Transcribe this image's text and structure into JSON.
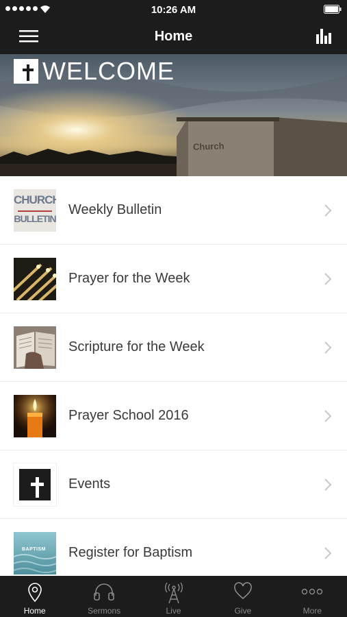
{
  "status_bar": {
    "time": "10:26 AM"
  },
  "nav": {
    "title": "Home"
  },
  "hero": {
    "welcome_text": "WELCOME",
    "building_sign": "Church"
  },
  "list": [
    {
      "label": "Weekly Bulletin",
      "thumb": "church-bulletin",
      "thumb_text_top": "CHURCH",
      "thumb_text_bottom": "BULLETIN"
    },
    {
      "label": "Prayer for the Week",
      "thumb": "candles"
    },
    {
      "label": "Scripture for the Week",
      "thumb": "open-bible"
    },
    {
      "label": "Prayer School 2016",
      "thumb": "candle-flame"
    },
    {
      "label": "Events",
      "thumb": "cross-logo"
    },
    {
      "label": "Register for Baptism",
      "thumb": "water",
      "thumb_text": "BAPTISM"
    }
  ],
  "tabs": [
    {
      "label": "Home",
      "icon": "location-pin-icon",
      "active": true
    },
    {
      "label": "Sermons",
      "icon": "headphones-icon",
      "active": false
    },
    {
      "label": "Live",
      "icon": "broadcast-tower-icon",
      "active": false
    },
    {
      "label": "Give",
      "icon": "heart-icon",
      "active": false
    },
    {
      "label": "More",
      "icon": "more-dots-icon",
      "active": false
    }
  ],
  "colors": {
    "bar_background": "#1c1c1c",
    "active_tab": "#ffffff",
    "inactive_tab": "#8a8a8a",
    "row_text": "#3a3a3a",
    "chevron": "#c7c7cc"
  }
}
